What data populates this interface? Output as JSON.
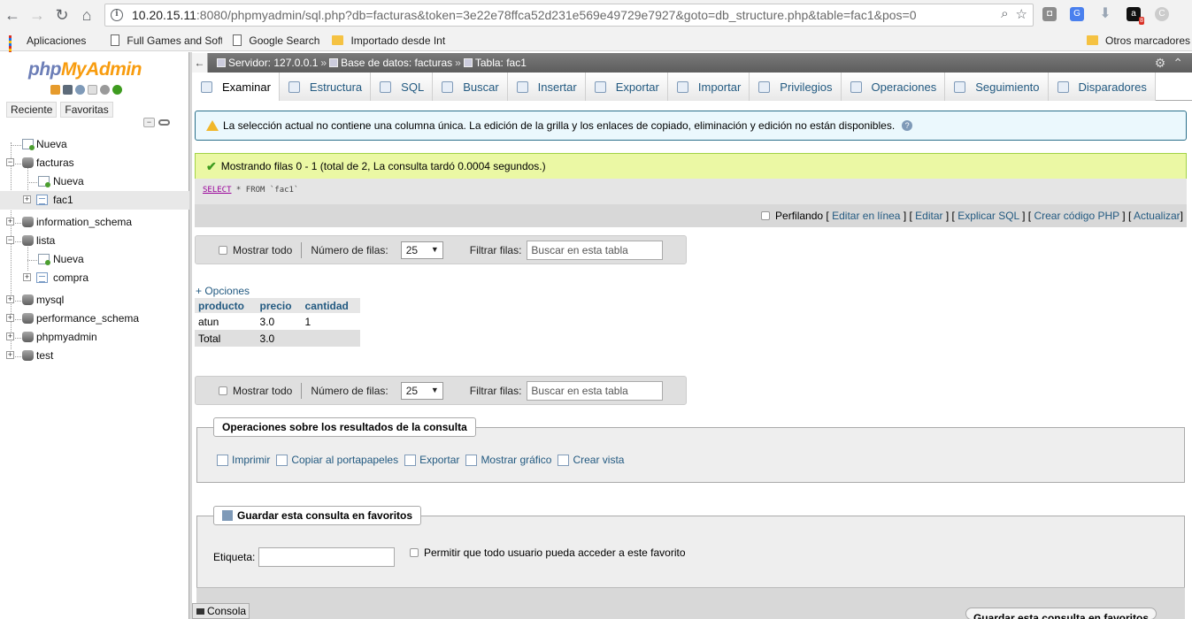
{
  "browser": {
    "url_host": "10.20.15.11",
    "url_rest": ":8080/phpmyadmin/sql.php?db=facturas&token=3e22e78ffca52d231e569e49729e7927&goto=db_structure.php&table=fac1&pos=0",
    "ext_badge": "8",
    "bookmarks": [
      "Aplicaciones",
      "Full Games and Soft",
      "Google Search",
      "Importado desde Int"
    ],
    "bookmarks_other": "Otros marcadores"
  },
  "sidebar": {
    "logo_php": "php",
    "logo_my": "MyAdmin",
    "tabs": [
      "Reciente",
      "Favoritas"
    ],
    "tree": [
      "Nueva",
      "facturas",
      "Nueva",
      "fac1",
      "information_schema",
      "lista",
      "Nueva",
      "compra",
      "mysql",
      "performance_schema",
      "phpmyadmin",
      "test"
    ]
  },
  "breadcrumb": {
    "server": "Servidor: 127.0.0.1",
    "database": "Base de datos: facturas",
    "table": "Tabla: fac1",
    "separator": "»"
  },
  "tabs": [
    "Examinar",
    "Estructura",
    "SQL",
    "Buscar",
    "Insertar",
    "Exportar",
    "Importar",
    "Privilegios",
    "Operaciones",
    "Seguimiento",
    "Disparadores"
  ],
  "notice": "La selección actual no contiene una columna única. La edición de la grilla y los enlaces de copiado, eliminación y edición no están disponibles.",
  "success": "Mostrando filas 0 - 1 (total de 2, La consulta tardó 0.0004 segundos.)",
  "sql": {
    "keyword": "SELECT",
    "rest": " * FROM `fac1`"
  },
  "sql_links": {
    "profiling": "Perfilando",
    "links": [
      "Editar en línea",
      "Editar",
      "Explicar SQL",
      "Crear código PHP",
      "Actualizar"
    ]
  },
  "navigation": {
    "show_all": "Mostrar todo",
    "rows_label": "Número de filas:",
    "rows_value": "25",
    "filter_label": "Filtrar filas:",
    "filter_placeholder": "Buscar en esta tabla"
  },
  "options_link": "+ Opciones",
  "results": {
    "columns": [
      "producto",
      "precio",
      "cantidad"
    ],
    "rows": [
      [
        "atun",
        "3.0",
        "1"
      ],
      [
        "Total",
        "3.0",
        ""
      ]
    ]
  },
  "query_ops": {
    "title": "Operaciones sobre los resultados de la consulta",
    "actions": [
      "Imprimir",
      "Copiar al portapapeles",
      "Exportar",
      "Mostrar gráfico",
      "Crear vista"
    ]
  },
  "bookmark": {
    "title": "Guardar esta consulta en favoritos",
    "label": "Etiqueta:",
    "checkbox": "Permitir que todo usuario pueda acceder a este favorito",
    "save_button": "Guardar esta consulta en favoritos"
  },
  "console": "Consola"
}
